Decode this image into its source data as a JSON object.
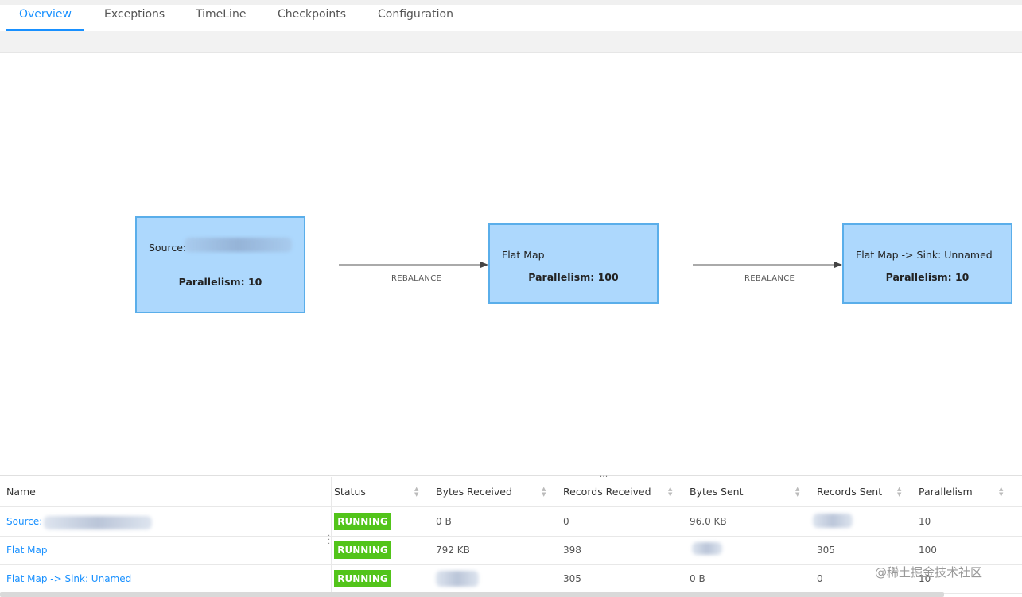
{
  "tabs": [
    {
      "label": "Overview",
      "active": true
    },
    {
      "label": "Exceptions",
      "active": false
    },
    {
      "label": "TimeLine",
      "active": false
    },
    {
      "label": "Checkpoints",
      "active": false
    },
    {
      "label": "Configuration",
      "active": false
    }
  ],
  "graph": {
    "nodes": [
      {
        "name": "Source:",
        "parallelism": "Parallelism: 10"
      },
      {
        "name": "Flat Map",
        "parallelism": "Parallelism: 100"
      },
      {
        "name": "Flat Map -> Sink: Unnamed",
        "parallelism": "Parallelism: 10"
      }
    ],
    "edges": [
      {
        "label": "REBALANCE"
      },
      {
        "label": "REBALANCE"
      }
    ]
  },
  "table": {
    "columns": [
      "Name",
      "Status",
      "Bytes Received",
      "Records Received",
      "Bytes Sent",
      "Records Sent",
      "Parallelism"
    ],
    "rows": [
      {
        "name": "Source:",
        "status": "RUNNING",
        "bytes_received": "0 B",
        "records_received": "0",
        "bytes_sent": "96.0 KB",
        "records_sent": "",
        "parallelism": "10"
      },
      {
        "name": "Flat Map",
        "status": "RUNNING",
        "bytes_received": "792 KB",
        "records_received": "398",
        "bytes_sent": "",
        "records_sent": "305",
        "parallelism": "100"
      },
      {
        "name": "Flat Map -> Sink: Unamed",
        "status": "RUNNING",
        "bytes_received": "",
        "records_received": "305",
        "bytes_sent": "0 B",
        "records_sent": "0",
        "parallelism": "10"
      }
    ]
  },
  "splitter_handle": "...",
  "watermark": "@稀土掘金技术社区",
  "colors": {
    "accent": "#1890ff",
    "node_fill": "#add8fd",
    "node_border": "#5aaeea",
    "running": "#52c41a"
  }
}
